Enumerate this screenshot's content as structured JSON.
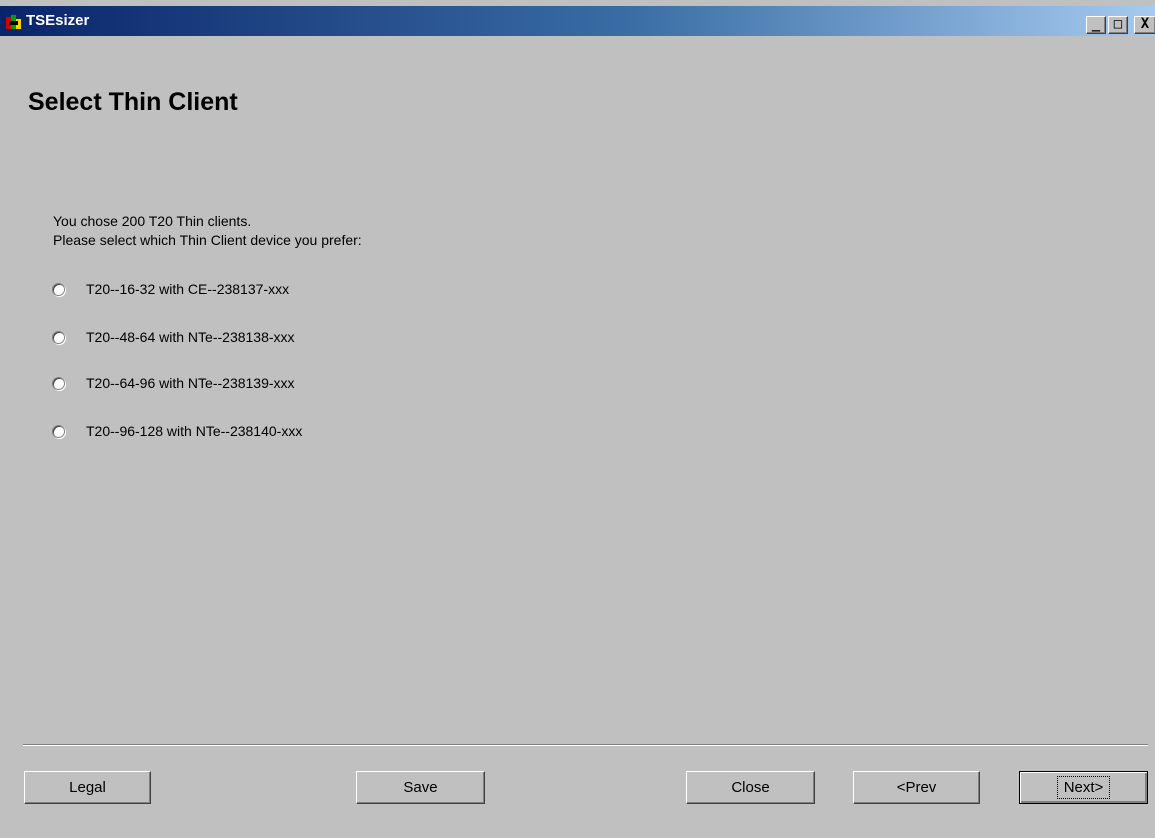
{
  "window": {
    "title": "TSEsizer",
    "controls": {
      "minimize": "_",
      "maximize": "□",
      "close": "X"
    }
  },
  "page": {
    "title": "Select Thin Client",
    "intro_line1": "You chose 200 T20 Thin clients.",
    "intro_line2": "Please select which Thin Client device you prefer:"
  },
  "options": [
    {
      "label": "T20--16-32 with CE--238137-xxx",
      "selected": false
    },
    {
      "label": "T20--48-64 with NTe--238138-xxx",
      "selected": false
    },
    {
      "label": "T20--64-96 with NTe--238139-xxx",
      "selected": false
    },
    {
      "label": "T20--96-128 with NTe--238140-xxx",
      "selected": false
    }
  ],
  "buttons": {
    "legal": "Legal",
    "save": "Save",
    "close": "Close",
    "prev": "<Prev",
    "next": "Next>"
  },
  "colors": {
    "window_bg": "#c0c0c0",
    "titlebar_start": "#0a246a",
    "titlebar_end": "#a6caf0"
  },
  "icons": {
    "app": "tsesizer-app-icon",
    "minimize": "minimize-icon",
    "maximize": "maximize-icon",
    "close": "close-icon"
  }
}
